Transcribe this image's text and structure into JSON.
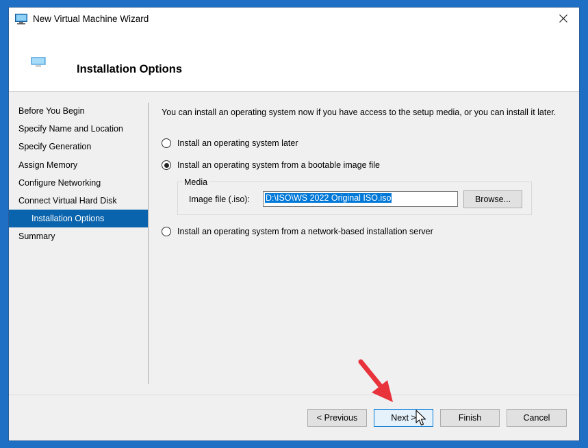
{
  "window": {
    "title": "New Virtual Machine Wizard",
    "close_icon": "close-icon"
  },
  "header": {
    "title": "Installation Options",
    "icon": "computer-screen-icon"
  },
  "steps": [
    {
      "label": "Before You Begin",
      "active": false
    },
    {
      "label": "Specify Name and Location",
      "active": false
    },
    {
      "label": "Specify Generation",
      "active": false
    },
    {
      "label": "Assign Memory",
      "active": false
    },
    {
      "label": "Configure Networking",
      "active": false
    },
    {
      "label": "Connect Virtual Hard Disk",
      "active": false
    },
    {
      "label": "Installation Options",
      "active": true
    },
    {
      "label": "Summary",
      "active": false
    }
  ],
  "content": {
    "intro": "You can install an operating system now if you have access to the setup media, or you can install it later.",
    "options": [
      {
        "label": "Install an operating system later",
        "checked": false
      },
      {
        "label": "Install an operating system from a bootable image file",
        "checked": true
      },
      {
        "label": "Install an operating system from a network-based installation server",
        "checked": false
      }
    ],
    "media": {
      "legend": "Media",
      "image_label": "Image file (.iso):",
      "image_value": "D:\\ISO\\WS 2022 Original ISO.iso",
      "browse_label": "Browse..."
    }
  },
  "buttons": {
    "previous": "< Previous",
    "next": "Next >",
    "finish": "Finish",
    "cancel": "Cancel"
  },
  "colors": {
    "accent": "#0a64ad",
    "desktop": "#1f6fc4",
    "arrow": "#e8323c"
  }
}
